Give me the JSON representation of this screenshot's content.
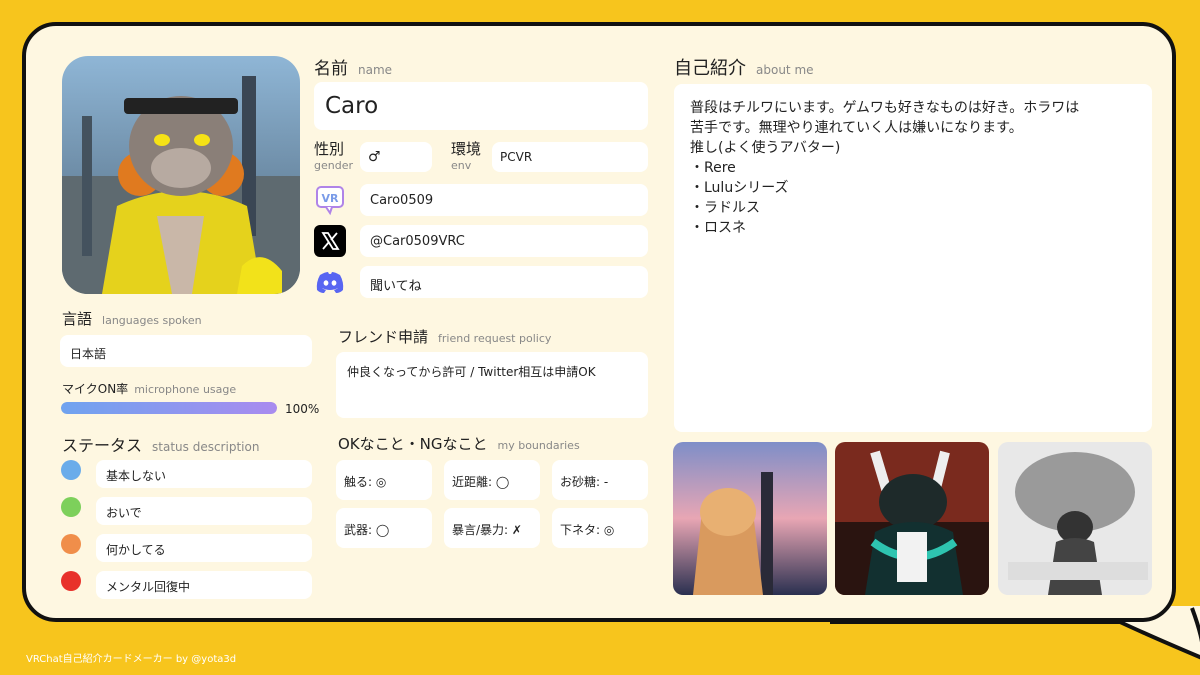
{
  "name_section": {
    "title": "名前",
    "subtitle": "name",
    "value": "Caro"
  },
  "gender": {
    "title": "性別",
    "subtitle": "gender",
    "value": "♂"
  },
  "env": {
    "title": "環境",
    "subtitle": "env",
    "value": "PCVR"
  },
  "accounts": {
    "vrchat": "Caro0509",
    "twitter": "@Car0509VRC",
    "discord": "聞いてね"
  },
  "icons": {
    "vrchat": "vrchat-icon",
    "twitter": "x-icon",
    "discord": "discord-icon",
    "vr_badge": "VR"
  },
  "about": {
    "title": "自己紹介",
    "subtitle": "about me",
    "lines": [
      "普段はチルワにいます。ゲムワも好きなものは好き。ホラワは",
      "苦手です。無理やり連れていく人は嫌いになります。",
      "推し(よく使うアバター)",
      "・Rere",
      "・Luluシリーズ",
      "・ラドルス",
      "・ロスネ"
    ]
  },
  "languages": {
    "title": "言語",
    "subtitle": "languages spoken",
    "value": "日本語"
  },
  "mic": {
    "title": "マイクON率",
    "subtitle": "microphone usage",
    "value": "100%",
    "level": 1.0
  },
  "status": {
    "title": "ステータス",
    "subtitle": "status description",
    "items": [
      {
        "color": "#6AACEA",
        "label": "基本しない"
      },
      {
        "color": "#7DD05B",
        "label": "おいで"
      },
      {
        "color": "#F08E4A",
        "label": "何かしてる"
      },
      {
        "color": "#E8312A",
        "label": "メンタル回復中"
      }
    ]
  },
  "friend": {
    "title": "フレンド申請",
    "subtitle": "friend request policy",
    "value": "仲良くなってから許可 / Twitter相互は申請OK"
  },
  "boundaries": {
    "title": "OKなこと・NGなこと",
    "subtitle": "my boundaries",
    "items": [
      "触る: ◎",
      "近距離: ◯",
      "お砂糖: -",
      "武器: ◯",
      "暴言/暴力: ✗",
      "下ネタ: ◎"
    ]
  },
  "footer": "VRChat自己紹介カードメーカー by @yota3d",
  "colors": {
    "background": "#F7C51D",
    "card": "#FEF7E1",
    "field": "#FFFFFF",
    "mic_bar_start": "#6FA3EF",
    "mic_bar_end": "#A98BEF"
  }
}
